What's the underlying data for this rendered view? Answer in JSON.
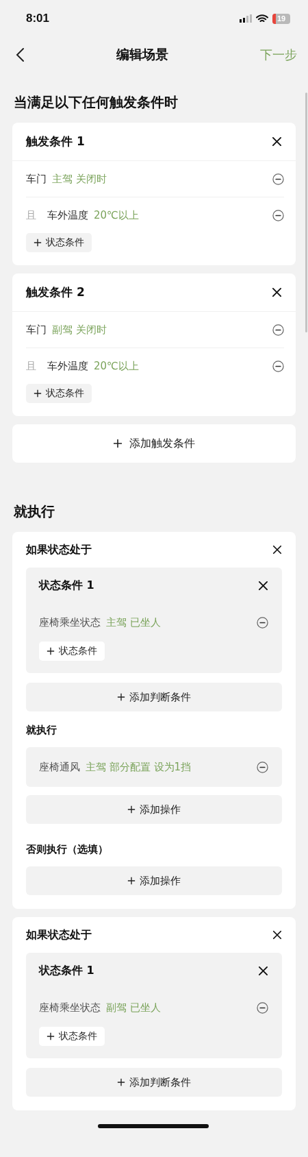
{
  "status_bar": {
    "time": "8:01",
    "battery": "19"
  },
  "nav": {
    "title": "编辑场景",
    "next": "下一步"
  },
  "triggers_section": {
    "title": "当满足以下任何触发条件时",
    "triggers": [
      {
        "title": "触发条件 1",
        "rows": [
          {
            "label": "车门",
            "value": "主驾 关闭时"
          },
          {
            "connector": "且",
            "label": "车外温度",
            "value": "20℃以上"
          }
        ],
        "add_label": "状态条件"
      },
      {
        "title": "触发条件 2",
        "rows": [
          {
            "label": "车门",
            "value": "副驾 关闭时"
          },
          {
            "connector": "且",
            "label": "车外温度",
            "value": "20℃以上"
          }
        ],
        "add_label": "状态条件"
      }
    ],
    "add_button": "添加触发条件"
  },
  "execute_section": {
    "title": "就执行",
    "blocks": [
      {
        "title": "如果状态处于",
        "conditions": [
          {
            "title": "状态条件 1",
            "rows": [
              {
                "label": "座椅乘坐状态",
                "value": "主驾 已坐人"
              }
            ],
            "add_label": "状态条件"
          }
        ],
        "add_condition": "添加判断条件",
        "then_label": "就执行",
        "actions": [
          {
            "label": "座椅通风",
            "value": "主驾 部分配置 设为1挡"
          }
        ],
        "add_action": "添加操作",
        "else_label": "否则执行（选填）",
        "else_add": "添加操作"
      },
      {
        "title": "如果状态处于",
        "conditions": [
          {
            "title": "状态条件 1",
            "rows": [
              {
                "label": "座椅乘坐状态",
                "value": "副驾 已坐人"
              }
            ],
            "add_label": "状态条件"
          }
        ],
        "add_condition": "添加判断条件"
      }
    ]
  }
}
